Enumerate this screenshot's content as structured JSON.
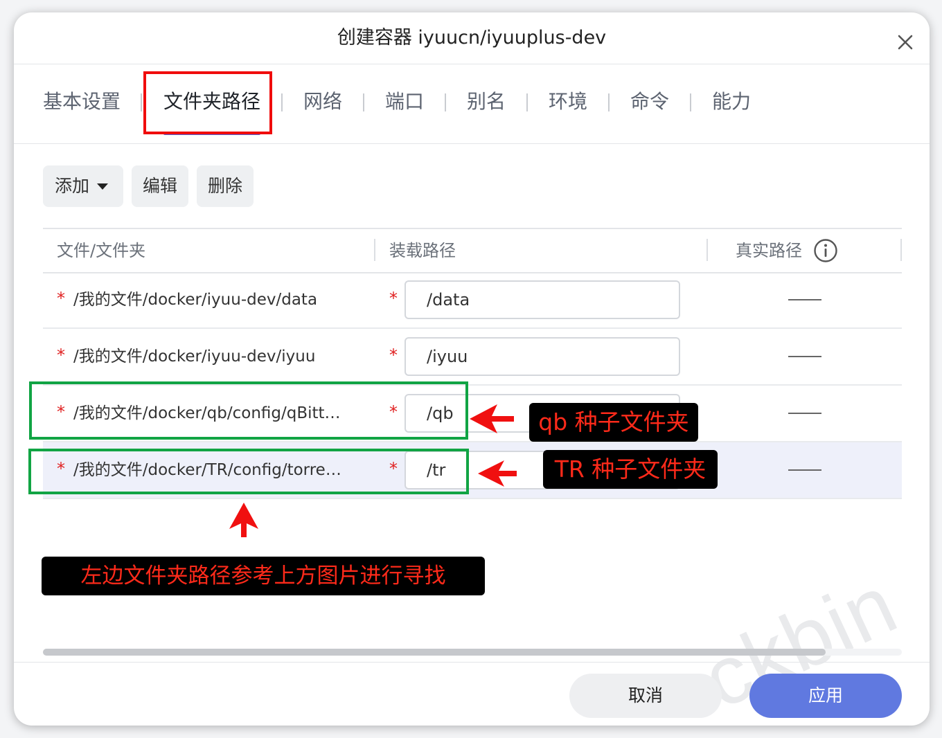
{
  "dialog": {
    "title": "创建容器 iyuucn/iyuuplus-dev"
  },
  "tabs": [
    {
      "label": "基本设置"
    },
    {
      "label": "文件夹路径",
      "active": true
    },
    {
      "label": "网络"
    },
    {
      "label": "端口"
    },
    {
      "label": "别名"
    },
    {
      "label": "环境"
    },
    {
      "label": "命令"
    },
    {
      "label": "能力"
    }
  ],
  "toolbar": {
    "add_label": "添加",
    "edit_label": "编辑",
    "delete_label": "删除"
  },
  "table": {
    "headers": [
      "文件/文件夹",
      "装载路径",
      "真实路径"
    ],
    "rows": [
      {
        "required_mark": "*",
        "path": "/我的文件/docker/iyuu-dev/data",
        "mount": "/data",
        "real_path": ""
      },
      {
        "required_mark": "*",
        "path": "/我的文件/docker/iyuu-dev/iyuu",
        "mount": "/iyuu",
        "real_path": ""
      },
      {
        "required_mark": "*",
        "path": "/我的文件/docker/qb/config/qBitt…",
        "mount": "/qb",
        "real_path": ""
      },
      {
        "required_mark": "*",
        "path": "/我的文件/docker/TR/config/torre…",
        "mount": "/tr",
        "real_path": "",
        "selected": true
      }
    ]
  },
  "annotations": {
    "qb_label": "qb 种子文件夹",
    "tr_label": "TR 种子文件夹",
    "left_note": "左边文件夹路径参考上方图片进行寻找"
  },
  "footer": {
    "cancel_label": "取消",
    "apply_label": "应用"
  },
  "watermark": "ckbin",
  "colors": {
    "accent": "#4a5fd8",
    "apply_button": "#6079e0",
    "annotation_red": "#f00c0c",
    "annotation_green": "#11a444",
    "required_star": "#e02020"
  },
  "icons": [
    "close-icon",
    "chevron-down-icon",
    "info-icon",
    "arrow-icon"
  ]
}
